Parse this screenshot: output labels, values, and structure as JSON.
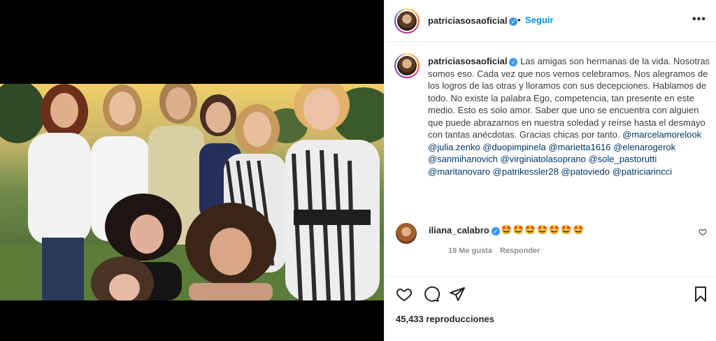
{
  "post": {
    "username": "patriciasosaoficial",
    "separator": "•",
    "follow_label": "Seguir",
    "more_label": "•••"
  },
  "caption": {
    "username": "patriciasosaoficial",
    "text": "Las amigas son hermanas de la vida. Nosotras somos eso. Cada vez que nos vemos celebramos. Nos alegramos de los logros de las otras y lloramos con sus decepciones. Hablamos de todo. No existe la palabra Ego, competencia, tan presente en este medio. Esto es solo amor. Saber que uno se encuentra con alguien que puede abrazarnos en nuestra soledad y reírse hasta el desmayo con tantas anécdotas. Gracias chicas por tanto.",
    "mentions": "@marcelamorelook @julia.zenko @duopimpinela @marietta1616 @elenarogerok @sanmihanovich @virginiatolasoprano @sole_pastorutti @maritanovaro @patrikessler28 @patoviedo @patriciarincci"
  },
  "comment": {
    "username": "iliana_calabro",
    "text": "🤩🤩🤩🤩🤩🤩🤩",
    "likes": "19 Me gusta",
    "reply_label": "Responder"
  },
  "stats": {
    "views": "45,433 reproducciones"
  },
  "icons": {
    "like": "heart-icon",
    "comment": "comment-icon",
    "share": "share-icon",
    "save": "bookmark-icon",
    "verified": "verified-badge-icon"
  },
  "colors": {
    "accent": "#0095f6",
    "verified": "#3897f0",
    "mention": "#00376b",
    "meta": "#8e8e8e"
  }
}
